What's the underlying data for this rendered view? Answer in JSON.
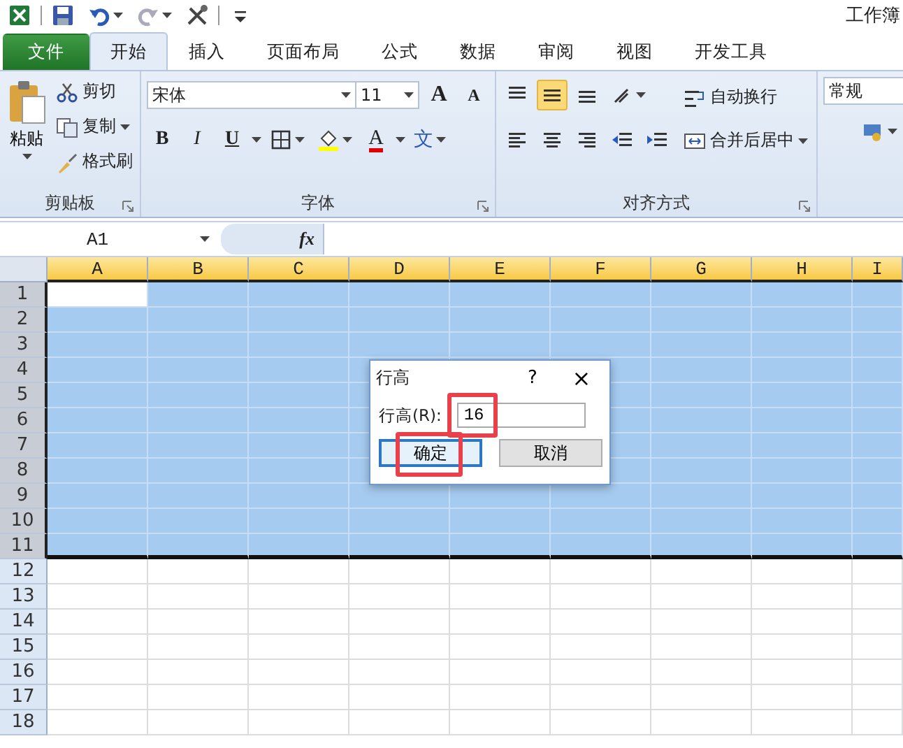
{
  "quick_access": {
    "title": "工作簿"
  },
  "tabs": [
    {
      "label": "文件",
      "kind": "file",
      "selected": false
    },
    {
      "label": "开始",
      "kind": "tab",
      "selected": true
    },
    {
      "label": "插入",
      "kind": "tab",
      "selected": false
    },
    {
      "label": "页面布局",
      "kind": "tab",
      "selected": false
    },
    {
      "label": "公式",
      "kind": "tab",
      "selected": false
    },
    {
      "label": "数据",
      "kind": "tab",
      "selected": false
    },
    {
      "label": "审阅",
      "kind": "tab",
      "selected": false
    },
    {
      "label": "视图",
      "kind": "tab",
      "selected": false
    },
    {
      "label": "开发工具",
      "kind": "tab",
      "selected": false
    }
  ],
  "clipboard": {
    "paste": "粘贴",
    "cut": "剪切",
    "copy": "复制",
    "format_painter": "格式刷",
    "group_label": "剪贴板"
  },
  "font": {
    "font_name": "宋体",
    "font_size": "11",
    "grow": "A",
    "shrink": "A",
    "bold": "B",
    "italic": "I",
    "underline": "U",
    "font_color": "A",
    "phonetic": "文",
    "group_label": "字体"
  },
  "alignment": {
    "buttons": [
      {
        "kind": "top",
        "selected": false
      },
      {
        "kind": "middle",
        "selected": true
      },
      {
        "kind": "bottom",
        "selected": false
      }
    ],
    "wrap_text": "自动换行",
    "merge_center": "合并后居中",
    "group_label": "对齐方式"
  },
  "number": {
    "format": "常规"
  },
  "formula_bar": {
    "name_box": "A1",
    "function_button": "fx"
  },
  "grid": {
    "columns": [
      {
        "label": "A",
        "selected": true
      },
      {
        "label": "B",
        "selected": true
      },
      {
        "label": "C",
        "selected": true
      },
      {
        "label": "D",
        "selected": true
      },
      {
        "label": "E",
        "selected": true
      },
      {
        "label": "F",
        "selected": true
      },
      {
        "label": "G",
        "selected": true
      },
      {
        "label": "H",
        "selected": true
      },
      {
        "label": "I",
        "selected": true
      }
    ],
    "rows": [
      {
        "label": "1",
        "selected": true
      },
      {
        "label": "2",
        "selected": true
      },
      {
        "label": "3",
        "selected": true
      },
      {
        "label": "4",
        "selected": true
      },
      {
        "label": "5",
        "selected": true
      },
      {
        "label": "6",
        "selected": true
      },
      {
        "label": "7",
        "selected": true
      },
      {
        "label": "8",
        "selected": true
      },
      {
        "label": "9",
        "selected": true
      },
      {
        "label": "10",
        "selected": true
      },
      {
        "label": "11",
        "selected": true
      },
      {
        "label": "12",
        "selected": false
      },
      {
        "label": "13",
        "selected": false
      },
      {
        "label": "14",
        "selected": false
      },
      {
        "label": "15",
        "selected": false
      },
      {
        "label": "16",
        "selected": false
      },
      {
        "label": "17",
        "selected": false
      },
      {
        "label": "18",
        "selected": false
      }
    ]
  },
  "dialog": {
    "title": "行高",
    "help": "?",
    "close": "×",
    "field_label": "行高(R):",
    "value": "16",
    "field_highlighted": true,
    "buttons": [
      {
        "label": "确定",
        "focused": true,
        "highlighted": true
      },
      {
        "label": "取消",
        "focused": false,
        "highlighted": false
      }
    ]
  }
}
